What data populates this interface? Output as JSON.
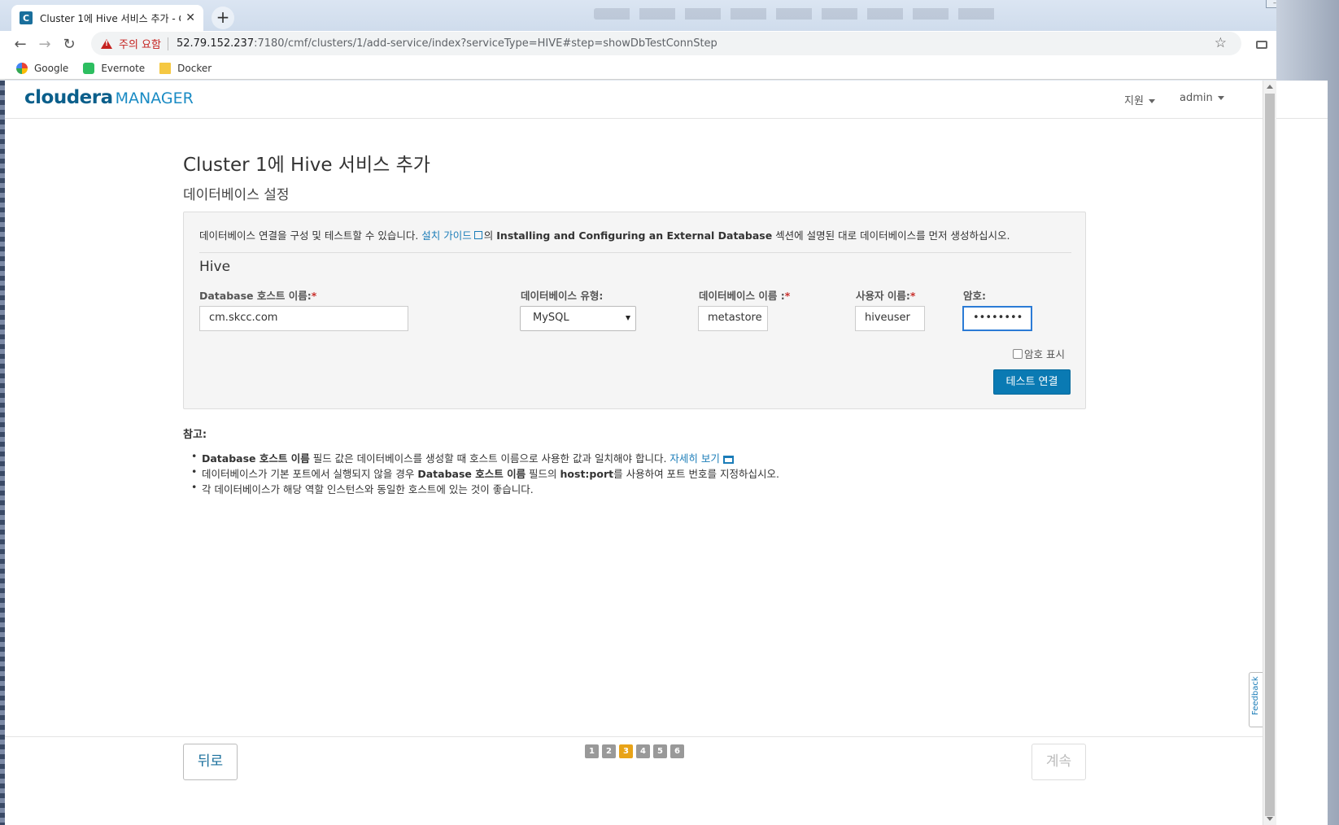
{
  "browser": {
    "tab_title": "Cluster 1에 Hive 서비스 추가 - C",
    "tab_favicon": "C",
    "new_tab": "+",
    "security_warning": "주의 요함",
    "url_host": "52.79.152.237",
    "url_path": ":7180/cmf/clusters/1/add-service/index?serviceType=HIVE#step=showDbTestConnStep",
    "bookmarks": [
      {
        "label": "Google",
        "icon": "google-icon"
      },
      {
        "label": "Evernote",
        "icon": "evernote-icon"
      },
      {
        "label": "Docker",
        "icon": "folder-icon"
      }
    ]
  },
  "header": {
    "logo_main": "cloudera",
    "logo_sub": "MANAGER",
    "support_menu": "지원",
    "user_menu": "admin"
  },
  "page": {
    "title": "Cluster 1에 Hive 서비스 추가",
    "subtitle": "데이터베이스 설정"
  },
  "panel": {
    "intro_before": "데이터베이스 연결을 구성 및 테스트할 수 있습니다. ",
    "intro_link": "설치 가이드",
    "intro_mid": "의 ",
    "intro_bold": "Installing and Configuring an External Database",
    "intro_after": " 섹션에 설명된 대로 데이터베이스를 먼저 생성하십시오.",
    "service_name": "Hive",
    "fields": {
      "host_label": "Database 호스트 이름:",
      "host_value": "cm.skcc.com",
      "type_label": "데이터베이스 유형:",
      "type_value": "MySQL",
      "name_label": "데이터베이스 이름 :",
      "name_value": "metastore",
      "user_label": "사용자 이름:",
      "user_value": "hiveuser",
      "password_label": "암호:",
      "password_value": "••••••••",
      "required_mark": "*"
    },
    "show_password_label": "암호 표시",
    "test_button": "테스트 연결"
  },
  "notes": {
    "title": "참고:",
    "item1_bold": "Database 호스트 이름",
    "item1_text": " 필드 값은 데이터베이스를 생성할 때 호스트 이름으로 사용한 값과 일치해야 합니다. ",
    "item1_link": "자세히 보기",
    "item2_text_a": "데이터베이스가 기본 포트에서 실행되지 않을 경우 ",
    "item2_bold_a": "Database 호스트 이름",
    "item2_text_b": " 필드의 ",
    "item2_bold_b": "host:port",
    "item2_text_c": "를 사용하여 포트 번호를 지정하십시오.",
    "item3_text": "각 데이터베이스가 해당 역할 인스턴스와 동일한 호스트에 있는 것이 좋습니다."
  },
  "footer": {
    "back_button": "뒤로",
    "next_button": "계속",
    "steps": [
      "1",
      "2",
      "3",
      "4",
      "5",
      "6"
    ],
    "current_step": "3"
  },
  "feedback_tab": "Feedback",
  "colors": {
    "primary": "#0a7ab3",
    "active_step": "#e8a317",
    "link": "#1a7cb8",
    "warning": "#c5221f"
  }
}
